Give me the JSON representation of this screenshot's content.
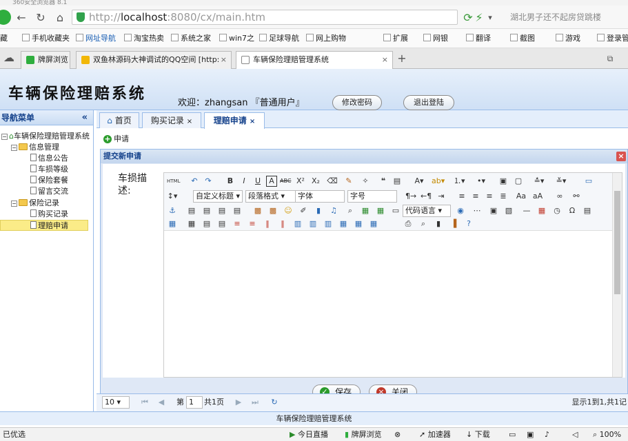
{
  "browser": {
    "window_title": "360安全浏览器 8.1",
    "url_host": "localhost",
    "url_prefix": "http://",
    "url_rest": ":8080/cx/main.htm",
    "search_hint": "湖北男子还不起房贷跳楼",
    "favorites": [
      "藏",
      "手机收藏夹",
      "网址导航",
      "淘宝热卖",
      "系统之家",
      "win7之",
      "足球导航",
      "网上购物",
      "扩展",
      "网银",
      "翻译",
      "截图",
      "游戏",
      "登录管"
    ],
    "tabs": [
      {
        "label": "牌屏浏览"
      },
      {
        "label": "双鱼林源码大神调试的QQ空间 [http:"
      },
      {
        "label": "车辆保险理赔管理系统"
      }
    ],
    "new_tab": "+"
  },
  "app": {
    "title": "车辆保险理赔系统",
    "welcome": "欢迎：zhangsan 『普通用户』",
    "change_password": "修改密码",
    "logout": "退出登陆",
    "sidebar": {
      "title": "导航菜单",
      "collapse": "«",
      "root": "车辆保险理赔管理系统",
      "groups": [
        {
          "label": "信息管理",
          "items": [
            "信息公告",
            "车损等级",
            "保险套餐",
            "留言交流"
          ]
        },
        {
          "label": "保险记录",
          "items": [
            "购买记录",
            "理赔申请"
          ]
        }
      ]
    },
    "content_tabs": [
      {
        "label": "首页"
      },
      {
        "label": "购买记录"
      },
      {
        "label": "理赔申请"
      }
    ],
    "toolbar_apply": "申请",
    "dialog": {
      "title": "提交新申请",
      "field_label": "车损描述:",
      "editor_selects": [
        "自定义标题",
        "段落格式",
        "字体",
        "字号",
        "代码语言"
      ],
      "save": "保存",
      "close": "关闭"
    },
    "pager": {
      "page_size": "10",
      "page_label_pre": "第",
      "page_value": "1",
      "page_label_post": "共1页",
      "summary": "显示1到1,共1记"
    },
    "footer": "车辆保险理赔管理系统"
  },
  "status": {
    "left": "已优选",
    "items": [
      "今日直播",
      "牌屏浏览",
      "加速器",
      "下载",
      "100%"
    ]
  },
  "colors": {
    "accent": "#99bbe8",
    "header_text": "#15428b",
    "selected": "#fbec88"
  }
}
